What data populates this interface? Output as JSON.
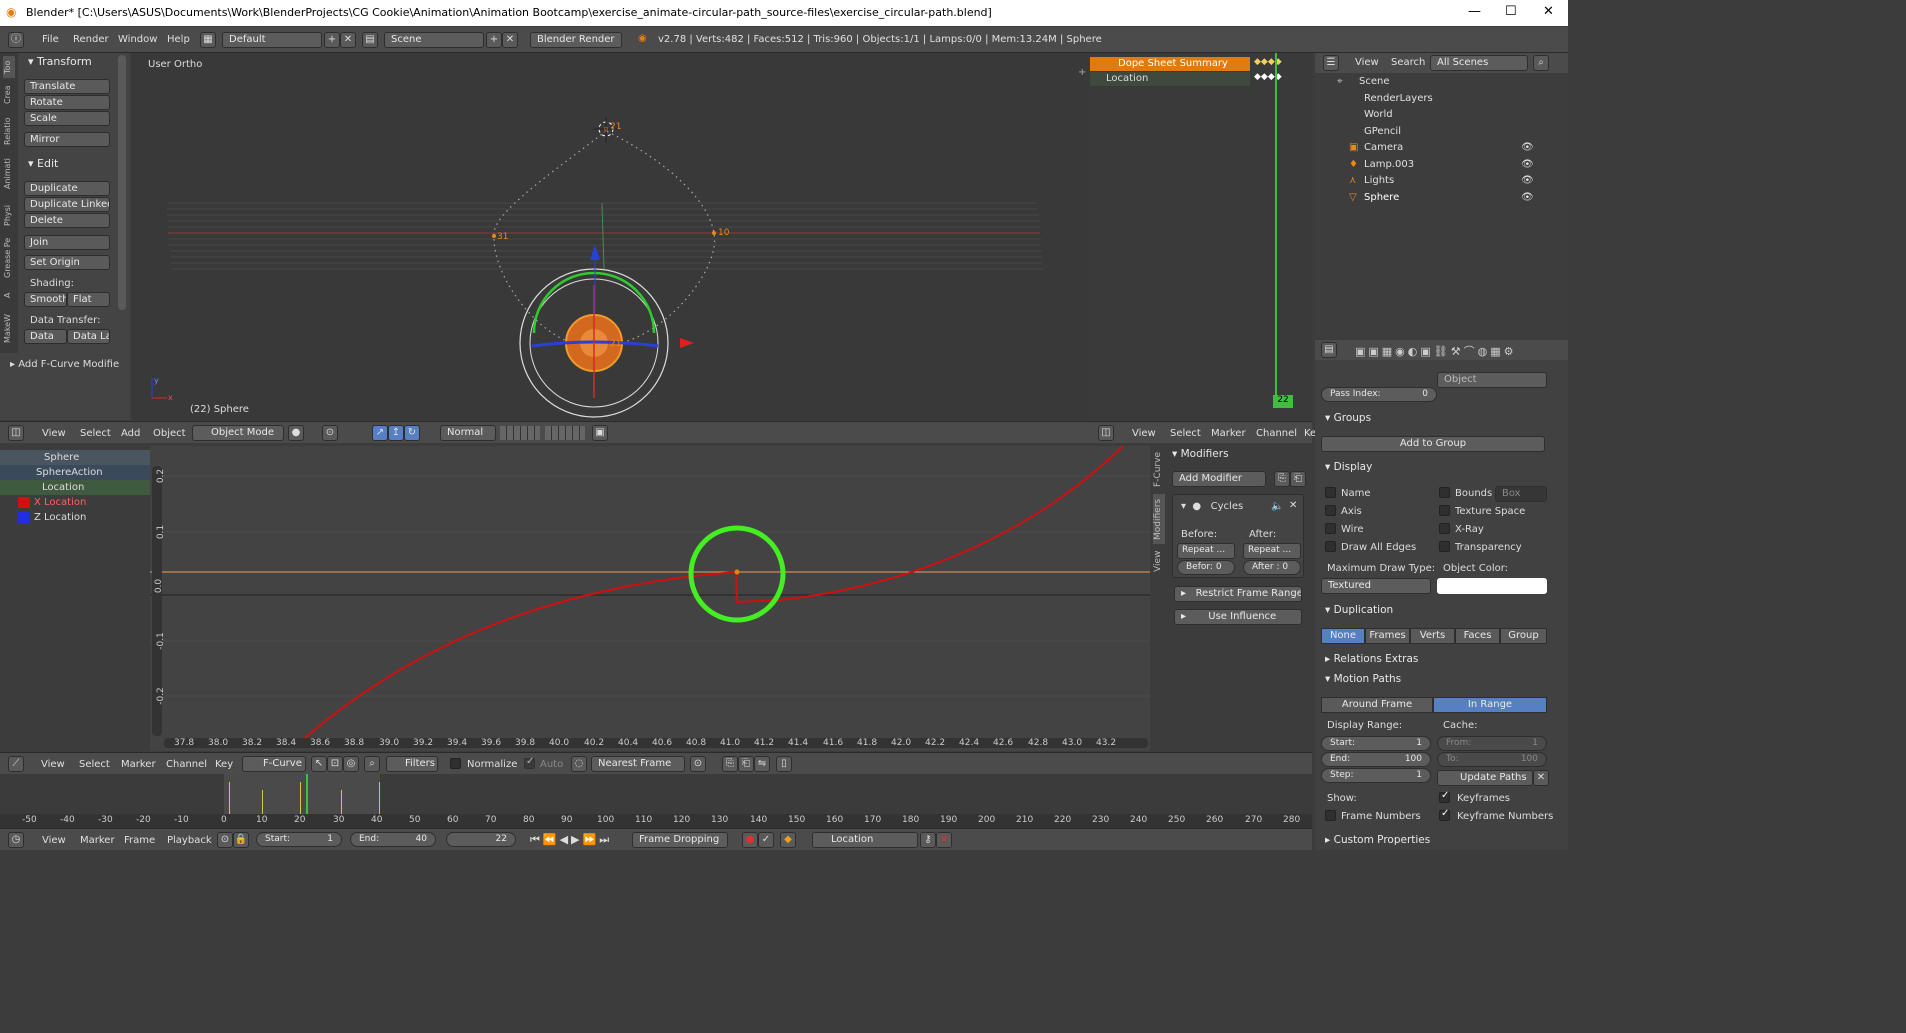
{
  "title": "Blender* [C:\\Users\\ASUS\\Documents\\Work\\BlenderProjects\\CG Cookie\\Animation\\Animation Bootcamp\\exercise_animate-circular-path_source-files\\exercise_circular-path.blend]",
  "topbar": {
    "menus": [
      "File",
      "Render",
      "Window",
      "Help"
    ],
    "layout": "Default",
    "scene": "Scene",
    "engine": "Blender Render",
    "stats": "v2.78 | Verts:482 | Faces:512 | Tris:960 | Objects:1/1 | Lamps:0/0 | Mem:13.24M | Sphere"
  },
  "tabs": [
    "Too",
    "Crea",
    "Relatio",
    "Animati",
    "Physi",
    "Grease Pe",
    "A",
    "MakeW"
  ],
  "toolshelf": {
    "transform_header": "Transform",
    "transform": [
      "Translate",
      "Rotate",
      "Scale",
      "Mirror"
    ],
    "edit_header": "Edit",
    "edit": [
      "Duplicate",
      "Duplicate Linked",
      "Delete",
      "Join"
    ],
    "set_origin": "Set Origin",
    "shading_label": "Shading:",
    "smooth": "Smooth",
    "flat": "Flat",
    "data_transfer_label": "Data Transfer:",
    "data": "Data",
    "data_la": "Data La",
    "add_fcurve": "Add F-Curve Modifie"
  },
  "viewport": {
    "view_label": "User Ortho",
    "object_label": "(22) Sphere",
    "frame_labels": [
      "21",
      "31",
      "10",
      "21"
    ],
    "menus": [
      "View",
      "Select",
      "Add",
      "Object"
    ],
    "mode": "Object Mode",
    "pivot": "Normal"
  },
  "dope": {
    "summary": "Dope Sheet Summary",
    "location": "Location",
    "frame": "22",
    "menus": [
      "View",
      "Select",
      "Marker",
      "Channel",
      "Ke"
    ]
  },
  "outliner": {
    "menus": [
      "View",
      "Search"
    ],
    "filter": "All Scenes",
    "items": [
      "Scene",
      "RenderLayers",
      "World",
      "GPencil",
      "Camera",
      "Lamp.003",
      "Lights",
      "Sphere"
    ]
  },
  "props": {
    "object": "Object",
    "pass_index_label": "Pass Index:",
    "pass_index": "0",
    "groups_header": "Groups",
    "add_to_group": "Add to Group",
    "display_header": "Display",
    "display_left": [
      "Name",
      "Axis",
      "Wire",
      "Draw All Edges"
    ],
    "display_right": [
      "Bounds",
      "Texture Space",
      "X-Ray",
      "Transparency"
    ],
    "bounds_value": "Box",
    "max_draw_label": "Maximum Draw Type:",
    "max_draw": "Textured",
    "object_color_label": "Object Color:",
    "duplication_header": "Duplication",
    "duplication": [
      "None",
      "Frames",
      "Verts",
      "Faces",
      "Group"
    ],
    "relations_extras": "Relations Extras",
    "motion_paths_header": "Motion Paths",
    "around_frame": "Around Frame",
    "in_range": "In Range",
    "display_range_label": "Display Range:",
    "cache_label": "Cache:",
    "start_label": "Start:",
    "start": "1",
    "end_label": "End:",
    "end": "100",
    "step_label": "Step:",
    "step": "1",
    "from_label": "From:",
    "from": "1",
    "to_label": "To:",
    "to": "100",
    "update_paths": "Update Paths",
    "show_label": "Show:",
    "frame_numbers": "Frame Numbers",
    "keyframes": "Keyframes",
    "keyframe_numbers": "Keyframe Numbers",
    "custom_properties": "Custom Properties"
  },
  "channels": [
    "Sphere",
    "SphereAction",
    "Location",
    "X Location",
    "Z Location"
  ],
  "graph": {
    "yticks": [
      "0.2",
      "0.1",
      "0.0",
      "-0.1",
      "-0.2"
    ],
    "xticks": [
      "37.8",
      "38.0",
      "38.2",
      "38.4",
      "38.6",
      "38.8",
      "39.0",
      "39.2",
      "39.4",
      "39.6",
      "39.8",
      "40.0",
      "40.2",
      "40.4",
      "40.6",
      "40.8",
      "41.0",
      "41.2",
      "41.4",
      "41.6",
      "41.8",
      "42.0",
      "42.2",
      "42.4",
      "42.6",
      "42.8",
      "43.0",
      "43.2"
    ],
    "side_tabs": [
      "F-Curve",
      "Modifiers",
      "View"
    ],
    "modifiers_header": "Modifiers",
    "add_modifier": "Add Modifier",
    "cycles": "Cycles",
    "before_label": "Before:",
    "after_label": "After:",
    "before_mode": "Repeat ...",
    "after_mode": "Repeat ...",
    "before_count": "Befor: 0",
    "after_count": "After : 0",
    "restrict": "Restrict Frame Range",
    "use_influence": "Use Influence",
    "menus": [
      "View",
      "Select",
      "Marker",
      "Channel",
      "Key"
    ],
    "mode": "F-Curve",
    "filters": "Filters",
    "normalize": "Normalize",
    "auto": "Auto",
    "snap": "Nearest Frame"
  },
  "timeline": {
    "ticks": [
      "-50",
      "-40",
      "-30",
      "-20",
      "-10",
      "0",
      "10",
      "20",
      "30",
      "40",
      "50",
      "60",
      "70",
      "80",
      "90",
      "100",
      "110",
      "120",
      "130",
      "140",
      "150",
      "160",
      "170",
      "180",
      "190",
      "200",
      "210",
      "220",
      "230",
      "240",
      "250",
      "260",
      "270",
      "280"
    ],
    "menus": [
      "View",
      "Marker",
      "Frame",
      "Playback"
    ],
    "start_label": "Start:",
    "start": "1",
    "end_label": "End:",
    "end": "40",
    "current": "22",
    "sync": "Frame Dropping",
    "keying_set": "Location"
  }
}
